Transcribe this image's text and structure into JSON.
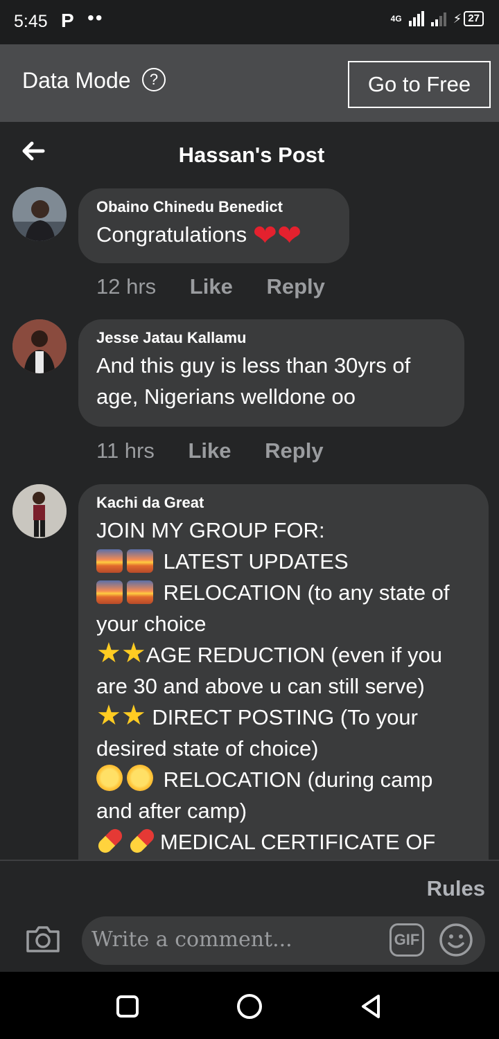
{
  "status_bar": {
    "time": "5:45",
    "app_icon": "P",
    "dots": "••",
    "network": "4G",
    "battery": "27"
  },
  "data_bar": {
    "label": "Data Mode",
    "help_symbol": "?",
    "go_free_label": "Go to Free"
  },
  "header": {
    "title": "Hassan's Post"
  },
  "comments": [
    {
      "author": "Obaino Chinedu Benedict",
      "lines": [
        "Congratulations"
      ],
      "emoji": "❤",
      "time": "12 hrs",
      "like": "Like",
      "reply": "Reply"
    },
    {
      "author": "Jesse Jatau Kallamu",
      "lines": [
        "And this guy is less than  30yrs of",
        "age, Nigerians welldone oo"
      ],
      "time": "11 hrs",
      "like": "Like",
      "reply": "Reply"
    },
    {
      "author": "Kachi da Great",
      "lines": [
        "JOIN MY GROUP FOR:",
        "LATEST UPDATES",
        "RELOCATION (to any state of",
        "your choice",
        "AGE REDUCTION (even if you",
        "are 30 and above u can still serve)",
        "DIRECT POSTING (To your",
        "desired state of choice)",
        "RELOCATION (during camp",
        "and after camp)",
        "MEDICAL CERTIFICATE OF"
      ],
      "star_glyph": "★"
    }
  ],
  "footer": {
    "rules_label": "Rules",
    "comment_placeholder": "Write a comment...",
    "gif_label": "GIF"
  },
  "colors": {
    "background": "#242526",
    "bubble": "#3a3b3c",
    "muted_text": "#9a9c9f"
  }
}
